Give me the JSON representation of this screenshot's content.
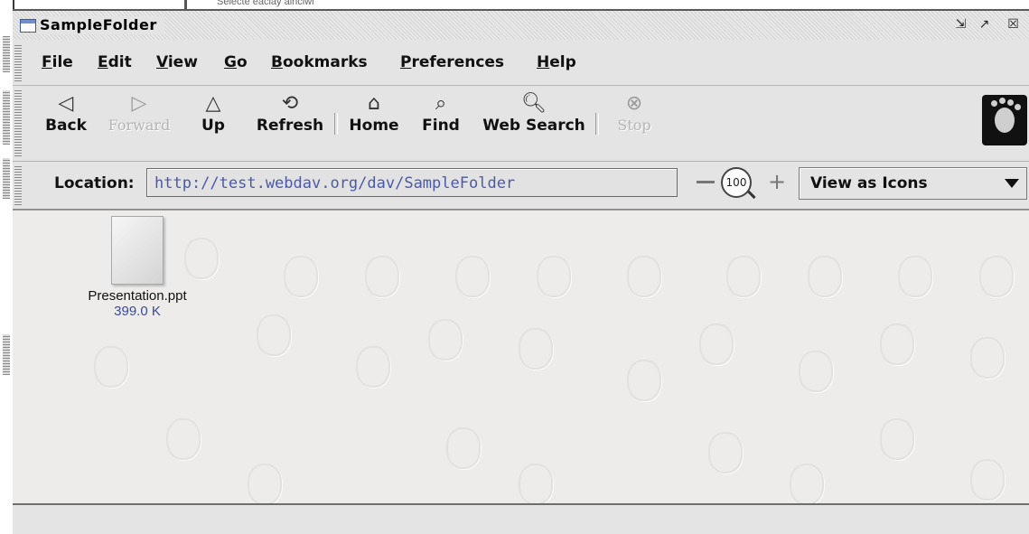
{
  "background_window": {
    "partial_text": "Selecte eaclay ainciwi"
  },
  "window": {
    "title": "SampleFolder",
    "controls": [
      "minimize-icon",
      "maximize-icon",
      "close-icon"
    ]
  },
  "menubar": {
    "items": [
      "File",
      "Edit",
      "View",
      "Go",
      "Bookmarks",
      "Preferences",
      "Help"
    ]
  },
  "toolbar": {
    "back": "Back",
    "forward": "Forward",
    "up": "Up",
    "refresh": "Refresh",
    "home": "Home",
    "find": "Find",
    "web_search": "Web Search",
    "stop": "Stop"
  },
  "location": {
    "label": "Location:",
    "url": "http://test.webdav.org/dav/SampleFolder",
    "zoom_level": "100",
    "view_mode": "View as Icons"
  },
  "files": [
    {
      "name": "Presentation.ppt",
      "size": "399.0 K"
    }
  ],
  "colors": {
    "link_text": "#4a5aa8",
    "window_bg": "#e4e4e4",
    "content_bg": "#edecea"
  }
}
